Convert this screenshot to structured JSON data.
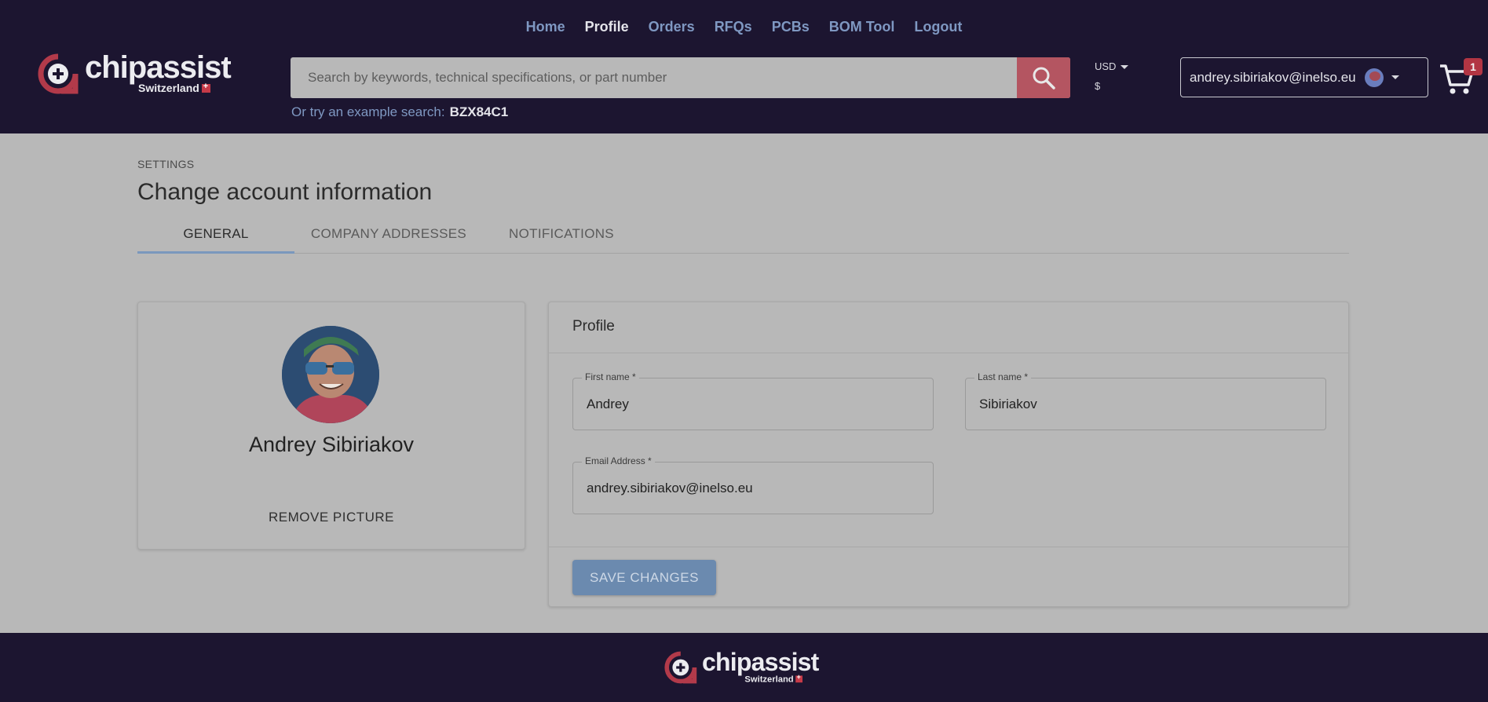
{
  "nav": {
    "items": [
      {
        "label": "Home",
        "active": false
      },
      {
        "label": "Profile",
        "active": true
      },
      {
        "label": "Orders",
        "active": false
      },
      {
        "label": "RFQs",
        "active": false
      },
      {
        "label": "PCBs",
        "active": false
      },
      {
        "label": "BOM Tool",
        "active": false
      },
      {
        "label": "Logout",
        "active": false
      }
    ]
  },
  "brand": {
    "name": "chipassist",
    "region": "Switzerland",
    "logo_icon": "chipassist-logo-icon"
  },
  "search": {
    "placeholder": "Search by keywords, technical specifications, or part number",
    "button_icon": "search-icon",
    "example_prefix": "Or try an example search:",
    "example_term": "BZX84C1"
  },
  "currency": {
    "code": "USD",
    "symbol": "$"
  },
  "account": {
    "email": "andrey.sibiriakov@inelso.eu"
  },
  "cart": {
    "count": "1"
  },
  "page": {
    "breadcrumb": "SETTINGS",
    "title": "Change account information",
    "tabs": [
      {
        "label": "GENERAL",
        "active": true
      },
      {
        "label": "COMPANY ADDRESSES",
        "active": false
      },
      {
        "label": "NOTIFICATIONS",
        "active": false
      }
    ]
  },
  "avatar_card": {
    "name": "Andrey Sibiriakov",
    "remove_label": "REMOVE PICTURE"
  },
  "profile": {
    "title": "Profile",
    "first_name_label": "First name *",
    "first_name": "Andrey",
    "last_name_label": "Last name *",
    "last_name": "Sibiriakov",
    "email_label": "Email Address *",
    "email": "andrey.sibiriakov@inelso.eu",
    "save_label": "SAVE CHANGES"
  },
  "colors": {
    "header_bg": "#1c1530",
    "nav_link": "#7f98c2",
    "accent_red": "#b45561",
    "save_button": "#6b8aaf",
    "content_bg": "#b8b8b8"
  }
}
